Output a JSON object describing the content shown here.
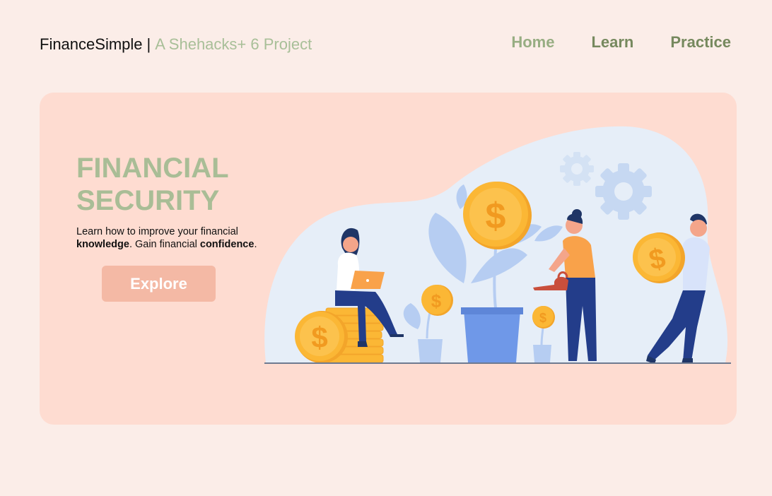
{
  "header": {
    "brand_name": "FinanceSimple",
    "brand_separator": "|",
    "brand_subtitle": "A Shehacks+ 6 Project",
    "nav": [
      "Home",
      "Learn",
      "Practice"
    ]
  },
  "hero": {
    "title": "FINANCIAL SECURITY",
    "text_1": "Learn how to improve your financial",
    "text_2_bold": "knowledge",
    "text_3": ". Gain financial",
    "text_4_bold": "confidence",
    "text_5": ".",
    "cta_label": "Explore",
    "coin_symbol": "$"
  },
  "colors": {
    "page_bg": "#fbede8",
    "hero_bg": "#fedcd1",
    "accent_green": "#a9bd96",
    "cta_bg": "#f4b9a5",
    "coin": "#fbb735"
  }
}
